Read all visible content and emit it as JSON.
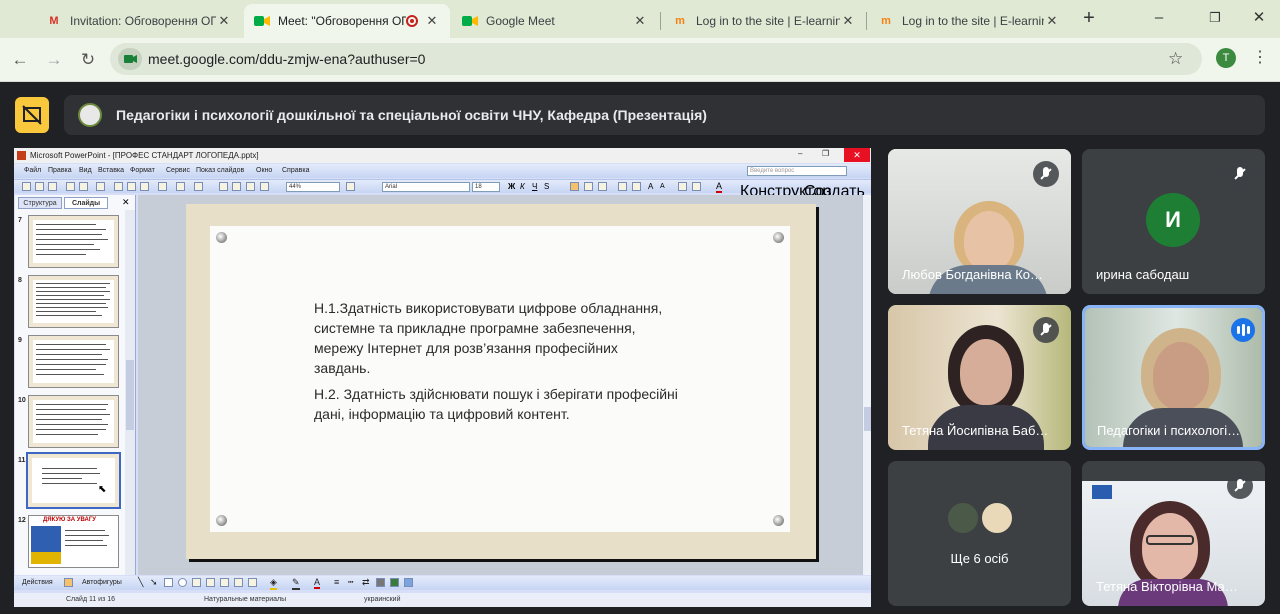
{
  "browser": {
    "tabs": [
      {
        "title": "Invitation: Обговорення ОП",
        "icon": "gmail-icon"
      },
      {
        "title": "Meet: \"Обговорення ОП",
        "icon": "meet-icon"
      },
      {
        "title": "Google Meet",
        "icon": "meet-icon"
      },
      {
        "title": "Log in to the site | E-learning",
        "icon": "moodle-icon"
      },
      {
        "title": "Log in to the site | E-learning",
        "icon": "moodle-icon"
      }
    ],
    "url": "meet.google.com/ddu-zmjw-ena?authuser=0",
    "profile_initial": "T"
  },
  "meet": {
    "presentation_title": "Педагогіки і психології дошкільної та спеціальної освіти ЧНУ, Кафедра (Презентація)",
    "participants": [
      {
        "name": "Любов Богданівна Ко…",
        "muted": true
      },
      {
        "name": "ирина сабодаш",
        "initial": "И",
        "muted": true
      },
      {
        "name": "Тетяна Йосипівна Баб…",
        "muted": true
      },
      {
        "name": "Педагогіки і психологі…",
        "speaking": true
      },
      {
        "name": "Ще 6 осіб"
      },
      {
        "name": "Тетяна Вікторівна Ма…",
        "muted": true
      }
    ]
  },
  "ppt": {
    "title": "Microsoft PowerPoint - [ПРОФЕС СТАНДАРТ ЛОГОПЕДА.pptx]",
    "search_placeholder": "Введите вопрос",
    "menu": [
      "Файл",
      "Правка",
      "Вид",
      "Вставка",
      "Формат",
      "Сервис",
      "Показ слайдов",
      "Окно",
      "Справка"
    ],
    "zoom": "44%",
    "font": "Arial",
    "font_size": "18",
    "designer": "Конструктор",
    "new_slide": "Создать слайд",
    "panel_tabs": [
      "Структура",
      "Слайды"
    ],
    "thumb_numbers": [
      "7",
      "8",
      "9",
      "10",
      "11",
      "12"
    ],
    "thumb12_title": "ДЯКУЮ ЗА УВАГУ",
    "slide_text_1": "Н.1.Здатність використовувати цифрове обладнання, системне та прикладне програмне забезпечення, мережу Інтернет для розв’язання професійних завдань.",
    "slide_text_2": "Н.2. Здатність здійснювати пошук і зберігати професійні дані, інформацію та цифровий контент.",
    "draw_actions": "Действия",
    "draw_autoshapes": "Автофигуры",
    "status_slide": "Слайд 11 из 16",
    "status_design": "Натуральные материалы",
    "status_lang": "украинский"
  }
}
